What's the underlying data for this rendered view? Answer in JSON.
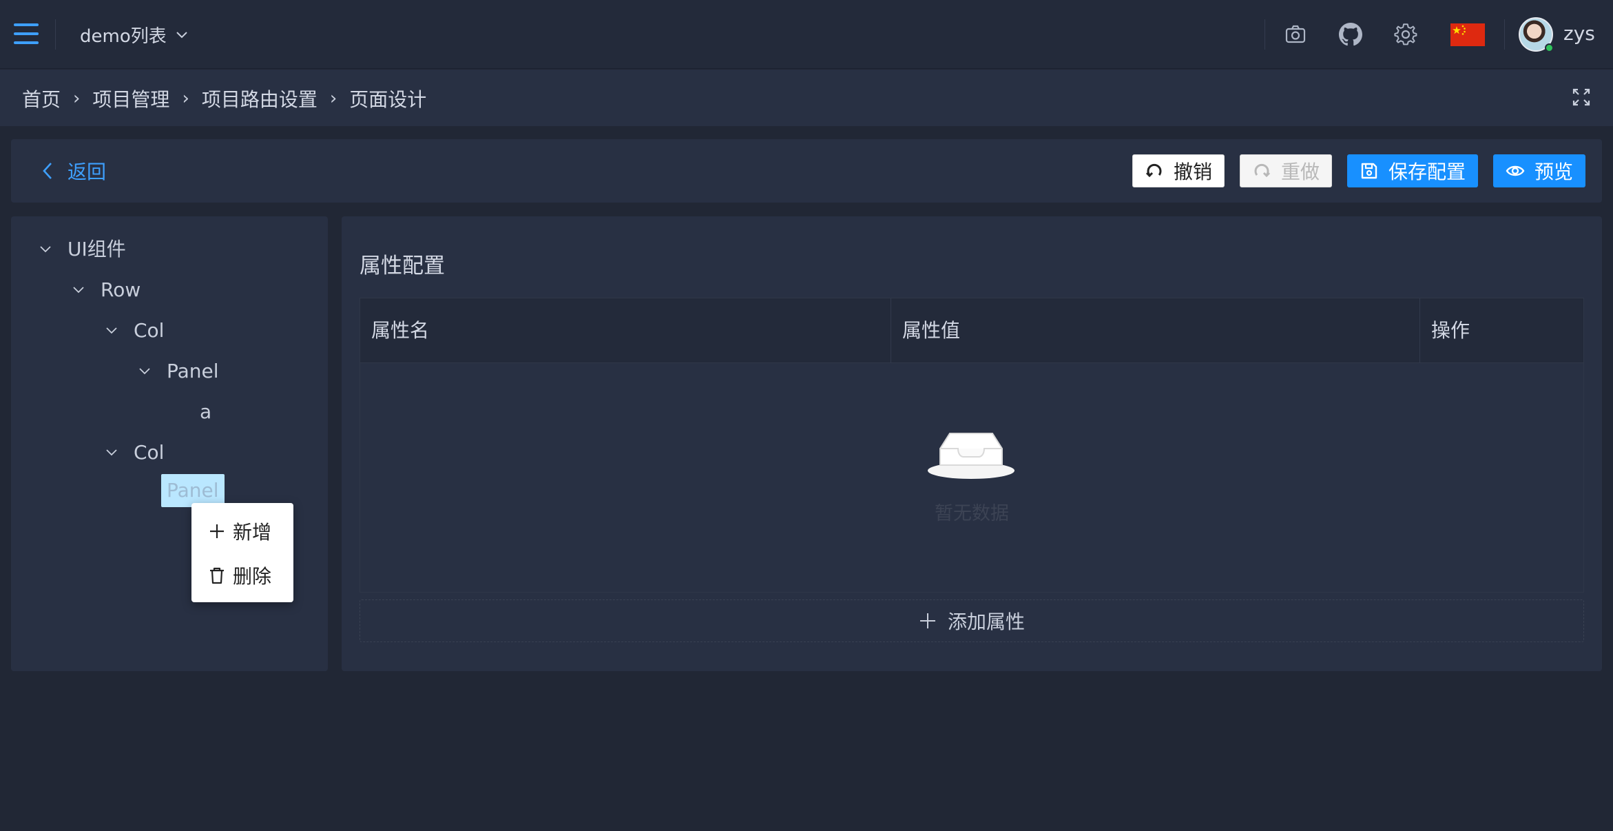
{
  "header": {
    "project_select": "demo列表",
    "username": "zys",
    "icons": [
      "menu-icon",
      "chevron-down-icon",
      "camera-icon",
      "github-icon",
      "gear-icon",
      "china-flag",
      "avatar"
    ]
  },
  "breadcrumb": {
    "items": [
      "首页",
      "项目管理",
      "项目路由设置",
      "页面设计"
    ],
    "separator": "›"
  },
  "toolbar": {
    "back_label": "返回",
    "undo_label": "撤销",
    "redo_label": "重做",
    "save_label": "保存配置",
    "preview_label": "预览"
  },
  "tree": {
    "nodes": [
      "UI组件",
      "Row",
      "Col",
      "Panel",
      "a",
      "Col",
      "Panel"
    ],
    "selected": "Panel"
  },
  "context_menu": {
    "add_label": "新增",
    "delete_label": "删除"
  },
  "properties": {
    "title": "属性配置",
    "columns": [
      "属性名",
      "属性值",
      "操作"
    ],
    "empty_text": "暂无数据",
    "add_label": "添加属性"
  },
  "colors": {
    "accent": "#1890ff",
    "link": "#3ea0ff",
    "background": "#212735",
    "panel": "#283043"
  }
}
